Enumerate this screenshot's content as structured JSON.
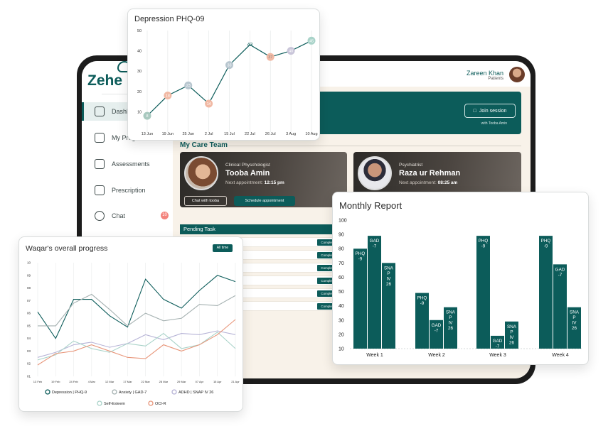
{
  "app": {
    "brand": "Zehe",
    "user": {
      "name": "Zareen Khan",
      "role": "Patients"
    }
  },
  "sidebar": {
    "items": [
      {
        "label": "Dashb",
        "icon": "dashboard-icon"
      },
      {
        "label": "My Prog",
        "icon": "progress-icon"
      },
      {
        "label": "Assessments",
        "icon": "assessments-icon"
      },
      {
        "label": "Prescription",
        "icon": "prescription-icon"
      },
      {
        "label": "Chat",
        "icon": "chat-icon",
        "badge": "10"
      }
    ]
  },
  "hero": {
    "join_label": "Join session",
    "join_sub": "with Tooba Amin"
  },
  "care_team": {
    "title": "My Care Team",
    "members": [
      {
        "role": "Clinical Physchologist",
        "name": "Tooba Amin",
        "appt_label": "Next appointment:",
        "appt_time": "12:15 pm",
        "chat_label": "Chat with tooba",
        "schedule_label": "Schedule appointment"
      },
      {
        "role": "Psychiatrist",
        "name": "Raza ur Rehman",
        "appt_label": "Next appointment:",
        "appt_time": "08:25 am"
      }
    ]
  },
  "pending": {
    "title": "Pending Task",
    "tasks": [
      {
        "status": "Complete"
      },
      {
        "status": "Complete"
      },
      {
        "status": "Complete"
      },
      {
        "status": "Complete"
      },
      {
        "status": "Complete"
      },
      {
        "status": "Complete"
      }
    ]
  },
  "colors": {
    "primary": "#0c5c5a",
    "accent_orange": "#e8967a",
    "grey": "#a5b1b1",
    "lilac": "#b6b3d6",
    "light_teal": "#a9d3c9"
  },
  "chart_data": [
    {
      "type": "line",
      "title": "Depression PHQ-09",
      "categories": [
        "13 Jun",
        "19 Jun",
        "25 Jun",
        "2 Jul",
        "15 Jul",
        "22 Jul",
        "26 Jul",
        "3 Aug",
        "10 Aug"
      ],
      "values": [
        8,
        18,
        23,
        14,
        33,
        43,
        37,
        40,
        45
      ],
      "ylim": [
        0,
        50
      ],
      "yticks": [
        10,
        20,
        30,
        40,
        50
      ],
      "y_ticklabels": [
        "10",
        "20",
        "30",
        "40",
        "50"
      ],
      "point_colors": [
        "#a9c9bf",
        "#f1b9a4",
        "#b8c6cf",
        "#f1b9a4",
        "#b8c6cf",
        "#0c5c5a",
        "#f1b9a4",
        "#c9c5d9",
        "#a9d3c9"
      ],
      "point_labels": [
        "8",
        "18",
        "23",
        "14",
        "33",
        "43",
        "37",
        "40",
        "45"
      ],
      "label_colors": [
        "#ffffff",
        "#ffffff",
        "#ffffff",
        "#ffffff",
        "#ffffff",
        "#0c5c5a",
        "#888888",
        "#ffffff",
        "#ffffff"
      ]
    },
    {
      "type": "bar",
      "title": "Monthly Report",
      "categories": [
        "Week 1",
        "Week 2",
        "Week 3",
        "Week 4"
      ],
      "ylim": [
        10,
        100
      ],
      "yticks": [
        10,
        20,
        30,
        40,
        50,
        60,
        70,
        80,
        90,
        100
      ],
      "y_ticklabels": [
        "10",
        "20",
        "30",
        "40",
        "50",
        "60",
        "70",
        "80",
        "90",
        "100"
      ],
      "series_labels": [
        "PHQ -9",
        "GAD -7",
        "SNA P IV 26"
      ],
      "values": [
        [
          80,
          89,
          70
        ],
        [
          49,
          30,
          39
        ],
        [
          89,
          19,
          29
        ],
        [
          89,
          69,
          39
        ]
      ]
    },
    {
      "type": "line",
      "title": "Waqar's overall progress",
      "filter_label": "All time",
      "categories": [
        "13 Feb",
        "19 Feb",
        "24 Feb",
        "4 Mar",
        "12 Mar",
        "17 Mar",
        "22 Mar",
        "28 Mar",
        "29 Mar",
        "07 Apr",
        "15 Apr",
        "21 Apr"
      ],
      "ylim": [
        1,
        10
      ],
      "yticks": [
        1,
        2,
        3,
        4,
        5,
        6,
        7,
        8,
        9,
        10
      ],
      "y_ticklabels": [
        "01",
        "02",
        "03",
        "04",
        "05",
        "06",
        "07",
        "08",
        "09",
        "10"
      ],
      "series": [
        {
          "name": "Depression | PHQ-9",
          "color": "#0c5c5a",
          "values": [
            6.1,
            4.0,
            7.1,
            7.1,
            5.8,
            4.9,
            8.7,
            7.1,
            6.4,
            7.8,
            9.0,
            8.5
          ]
        },
        {
          "name": "Anxiety | GAD-7",
          "color": "#a5b1b1",
          "values": [
            5.0,
            5.0,
            6.8,
            7.5,
            6.3,
            5.0,
            6.0,
            5.4,
            5.6,
            6.7,
            6.6,
            7.4
          ]
        },
        {
          "name": "ADHD | SNAP IV 26",
          "color": "#b6b3d6",
          "values": [
            2.5,
            2.9,
            3.5,
            3.7,
            3.3,
            3.6,
            4.3,
            3.9,
            4.4,
            4.3,
            4.6,
            4.3
          ]
        },
        {
          "name": "Self-Esteem",
          "color": "#a9d3c9",
          "values": [
            2.3,
            2.7,
            3.8,
            3.2,
            2.9,
            3.6,
            3.4,
            4.4,
            3.2,
            3.5,
            4.5,
            3.2
          ]
        },
        {
          "name": "OCI-R",
          "color": "#e8967a",
          "values": [
            1.9,
            2.8,
            3.0,
            3.5,
            3.0,
            2.5,
            2.4,
            3.5,
            3.0,
            3.5,
            4.3,
            5.5
          ]
        }
      ]
    }
  ]
}
